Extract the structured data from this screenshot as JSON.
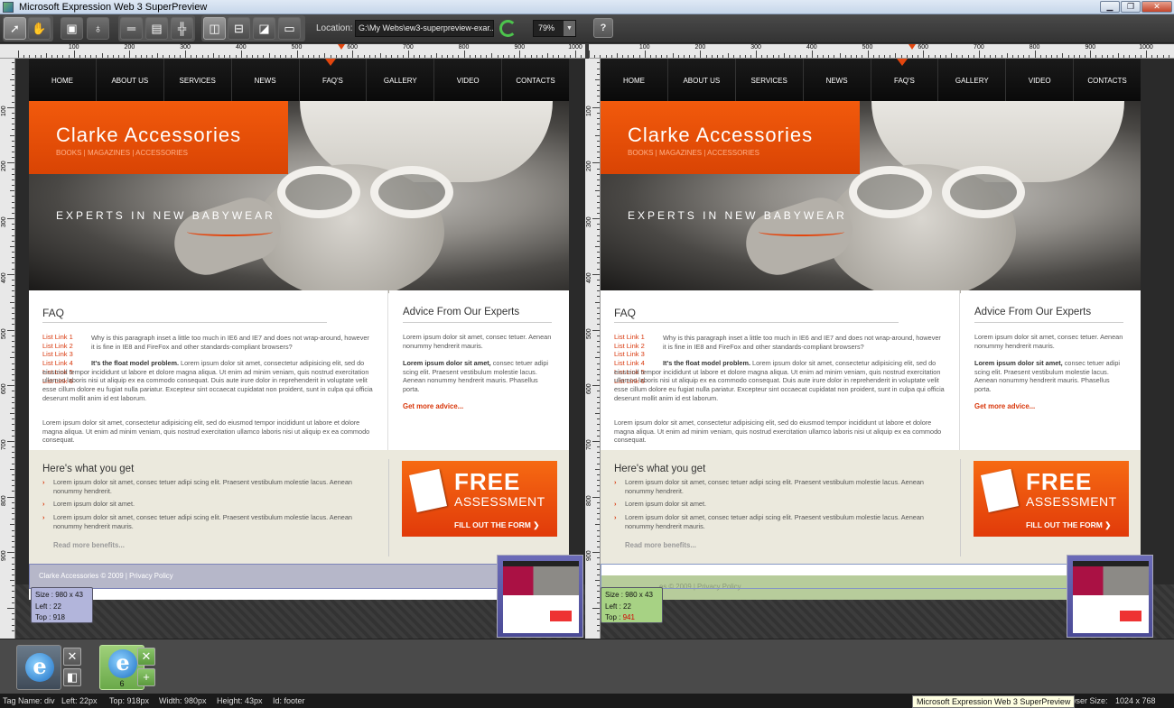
{
  "window": {
    "title": "Microsoft Expression Web 3 SuperPreview",
    "minimize": "▁",
    "maximize": "❐",
    "close": "✕"
  },
  "toolbar": {
    "location_label": "Location:",
    "location_value": "G:\\My Webs\\ew3-superpreview-exar...",
    "zoom_value": "79%",
    "help_glyph": "?"
  },
  "ruler": {
    "h_labels": [
      "100",
      "200",
      "300",
      "400",
      "500",
      "600",
      "700",
      "800",
      "900",
      "1000"
    ],
    "v_labels": [
      "100",
      "200",
      "300",
      "400",
      "500",
      "600",
      "700",
      "800",
      "900"
    ]
  },
  "site": {
    "nav": [
      "HOME",
      "ABOUT US",
      "SERVICES",
      "NEWS",
      "FAQ'S",
      "GALLERY",
      "VIDEO",
      "CONTACTS"
    ],
    "brand_title": "Clarke Accessories",
    "brand_sub": "BOOKS | MAGAZINES | ACCESSORIES",
    "tagline": "EXPERTS IN NEW BABYWEAR",
    "faq_heading": "FAQ",
    "faq_links": [
      "List Link 1",
      "List Link 2",
      "List Link 3",
      "List Link 4",
      "List Link 5",
      "List Link 6"
    ],
    "faq_p1": "Why is this paragraph inset a little too much in IE6 and IE7 and does not wrap-around, however it is fine in IE8 and FireFox and other standards-compliant browsers?",
    "faq_p2_bold": "It's the float model problem.",
    "faq_p2": " Lorem ipsum dolor sit amet, consectetur adipisicing elit, sed do eiusmod tempor incididunt ut labore et dolore magna aliqua. Ut enim ad minim veniam, quis nostrud exercitation ullamco laboris nisi ut aliquip ex ea commodo consequat. Duis aute irure dolor in reprehenderit in voluptate velit esse cillum dolore eu fugiat nulla pariatur. Excepteur sint occaecat cupidatat non proident, sunt in culpa qui officia deserunt mollit anim id est laborum.",
    "faq_p3": "Lorem ipsum dolor sit amet, consectetur adipisicing elit, sed do eiusmod tempor incididunt ut labore et dolore magna aliqua. Ut enim ad minim veniam, quis nostrud exercitation ullamco laboris nisi ut aliquip ex ea commodo consequat.",
    "advice_heading": "Advice From Our Experts",
    "advice_p1": "Lorem ipsum dolor sit amet, consec tetuer. Aenean nonummy hendrerit mauris.",
    "advice_p2_bold": "Lorem ipsum dolor sit amet,",
    "advice_p2": " consec tetuer adipi scing elit. Praesent vestibulum molestie lacus. Aenean nonummy hendrerit mauris. Phasellus porta.",
    "advice_more": "Get more advice...",
    "benefits_heading": "Here's what you get",
    "benefits": [
      "Lorem ipsum dolor sit amet, consec tetuer adipi scing elit. Praesent vestibulum molestie lacus. Aenean nonummy hendrerit.",
      "Lorem ipsum dolor sit amet.",
      "Lorem ipsum dolor sit amet, consec tetuer adipi scing elit. Praesent vestibulum molestie lacus. Aenean nonummy hendrerit mauris."
    ],
    "benefits_more": "Read more benefits...",
    "free_t1": "FREE",
    "free_t2": "ASSESSMENT",
    "free_t3": "FILL OUT THE FORM ❯",
    "footer_text": "Clarke Accessories © 2009 | ",
    "footer_link": "Privacy Policy",
    "footer2_text": "es © 2009 | Privacy Policy"
  },
  "left_info": {
    "size": "Size : 980 x 43",
    "left": "Left : 22",
    "top_label": "Top : ",
    "top_val": "918"
  },
  "right_info": {
    "size": "Size : 980 x 43",
    "left": "Left : 22",
    "top_label": "Top : ",
    "top_val": "941"
  },
  "tray": {
    "item2_num": "6",
    "close": "✕",
    "add": "+",
    "split": "◧"
  },
  "status": {
    "tag": "Tag Name: div",
    "left": "Left: 22px",
    "top": "Top: 918px",
    "width": "Width: 980px",
    "height": "Height: 43px",
    "id": "Id: footer",
    "browser_size_label": "wser Size:",
    "browser_size_value": "1024 x 768",
    "tooltip": "Microsoft Expression Web 3 SuperPreview"
  },
  "colors": {
    "accent": "#e3460e",
    "left_info_bg": "#b2b5db",
    "right_info_bg": "#a7d284",
    "diff_red": "#d40000"
  }
}
